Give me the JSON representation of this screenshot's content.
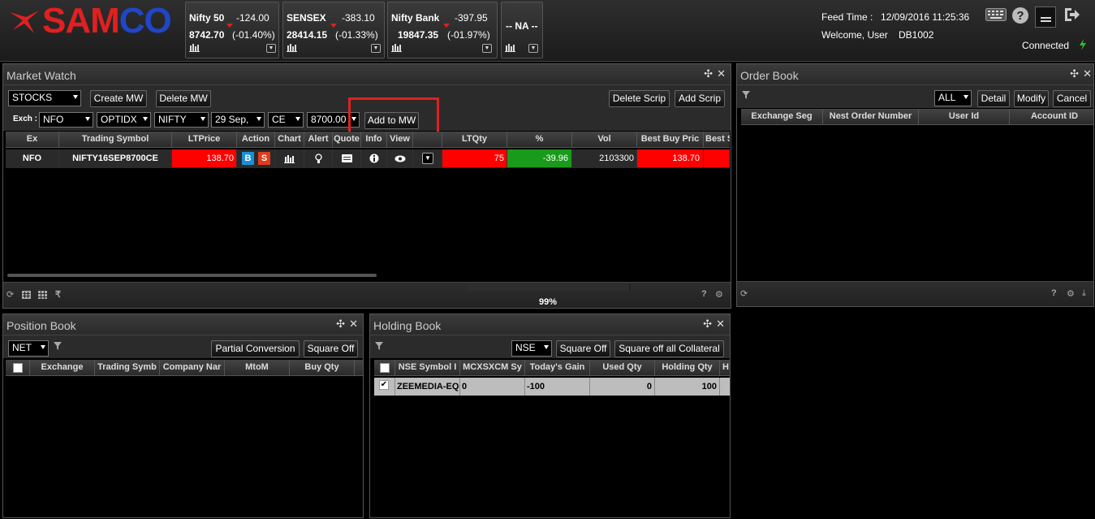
{
  "header": {
    "logo_red": "SAM",
    "logo_blue": "CO",
    "tickers": [
      {
        "name": "Nifty 50",
        "change": "-124.00",
        "value": "8742.70",
        "pct": "(-01.40%)"
      },
      {
        "name": "SENSEX",
        "change": "-383.10",
        "value": "28414.15",
        "pct": "(-01.33%)"
      },
      {
        "name": "Nifty Bank",
        "change": "-397.95",
        "value": "19847.35",
        "pct": "(-01.97%)"
      },
      {
        "name": "-- NA --",
        "change": "",
        "value": "",
        "pct": ""
      }
    ],
    "feed_time_label": "Feed Time :",
    "feed_time": "12/09/2016 11:25:36",
    "welcome": "Welcome, User",
    "user_id": "DB1002",
    "connection": "Connected"
  },
  "market_watch": {
    "title": "Market Watch",
    "list_select": "STOCKS",
    "create_label": "Create MW",
    "delete_label": "Delete MW",
    "delete_scrip_label": "Delete Scrip",
    "add_scrip_label": "Add Scrip",
    "exch_label": "Exch :",
    "filters": {
      "exchange": "NFO",
      "instrument": "OPTIDX",
      "symbol": "NIFTY",
      "expiry": "29 Sep,",
      "option": "CE",
      "strike": "8700.00"
    },
    "add_to_mw_label": "Add to MW",
    "columns": [
      "Ex",
      "Trading Symbol",
      "LTPrice",
      "Action",
      "Chart",
      "Alert",
      "Quote",
      "Info",
      "View",
      "",
      "LTQty",
      "%",
      "Vol",
      "Best Buy Pric",
      "Best S"
    ],
    "row": {
      "ex": "NFO",
      "symbol": "NIFTY16SEP8700CE",
      "ltprice": "138.70",
      "buy": "B",
      "sell": "S",
      "ltqty": "75",
      "pct": "-39.96",
      "vol": "2103300",
      "best_buy": "138.70"
    },
    "progress": "99%"
  },
  "order_book": {
    "title": "Order Book",
    "filter": "ALL",
    "detail_label": "Detail",
    "modify_label": "Modify",
    "cancel_label": "Cancel",
    "columns": [
      "Exchange Seg",
      "Nest Order Number",
      "User Id",
      "Account ID"
    ]
  },
  "position_book": {
    "title": "Position Book",
    "filter": "NET",
    "partial_label": "Partial Conversion",
    "square_label": "Square Off",
    "columns": [
      "Exchange",
      "Trading Symb",
      "Company Nar",
      "MtoM",
      "Buy Qty"
    ]
  },
  "holding_book": {
    "title": "Holding Book",
    "exchange": "NSE",
    "square_label": "Square Off",
    "square_all_label": "Square off all Collateral",
    "columns": [
      "NSE Symbol I",
      "MCXSXCM Sy",
      "Today's Gain",
      "Used Qty",
      "Holding Qty",
      "H"
    ],
    "row": {
      "symbol": "ZEEMEDIA-EQ",
      "mcx": "0",
      "gain": "-100",
      "used": "0",
      "holding": "100"
    }
  },
  "colors": {
    "red": "#ff0000",
    "green": "#1a9a1a",
    "buy_blue": "#1a8fd6",
    "sell_red": "#e03b1d",
    "highlight": "#e02020"
  }
}
